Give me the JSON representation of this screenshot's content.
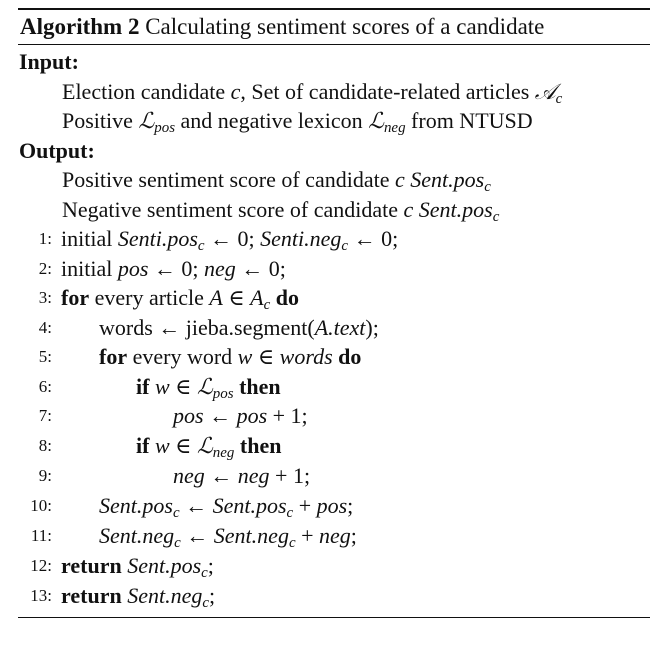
{
  "caption": {
    "label": "Algorithm 2",
    "text": "Calculating sentiment scores of a candidate"
  },
  "input": {
    "title": "Input:",
    "line1_a": "Election candidate ",
    "line1_b": ", Set of candidate-related articles ",
    "line2_a": "Positive ",
    "line2_b": " and negative lexicon ",
    "line2_c": " from NTUSD"
  },
  "output": {
    "title": "Output:",
    "line1": "Positive sentiment score of candidate ",
    "line2": "Negative sentiment score of candidate "
  },
  "lines": [
    {
      "num": "1:",
      "indent": 0
    },
    {
      "num": "2:",
      "indent": 0
    },
    {
      "num": "3:",
      "indent": 0
    },
    {
      "num": "4:",
      "indent": 1
    },
    {
      "num": "5:",
      "indent": 1
    },
    {
      "num": "6:",
      "indent": 2
    },
    {
      "num": "7:",
      "indent": 3
    },
    {
      "num": "8:",
      "indent": 2
    },
    {
      "num": "9:",
      "indent": 3
    },
    {
      "num": "10:",
      "indent": 1
    },
    {
      "num": "11:",
      "indent": 1
    },
    {
      "num": "12:",
      "indent": 0
    },
    {
      "num": "13:",
      "indent": 0
    }
  ],
  "keywords": {
    "initial": "initial",
    "for": "for",
    "do": "do",
    "if": "if",
    "then": "then",
    "return": "return",
    "every_article": " every article ",
    "every_word": " every word ",
    "words": "words",
    "jieba": "jieba.segment("
  },
  "math": {
    "c": "c",
    "A_c_cal": "𝒜",
    "L_cal": "ℒ",
    "sub_c": "c",
    "sub_pos": "pos",
    "sub_neg": "neg",
    "Sent_pos": "Sent.pos",
    "Senti_pos": "Senti.pos",
    "Senti_neg": "Senti.neg",
    "Sent_neg": "Sent.neg",
    "pos": "pos",
    "neg": "neg",
    "A": "A",
    "w": "w",
    "words_it": "words",
    "A_text": "A.text",
    "arrow": " ← ",
    "zero": "0",
    "one": "1",
    "in": " ∈ ",
    "plus": " + ",
    "semi": ";",
    "close": ");"
  }
}
